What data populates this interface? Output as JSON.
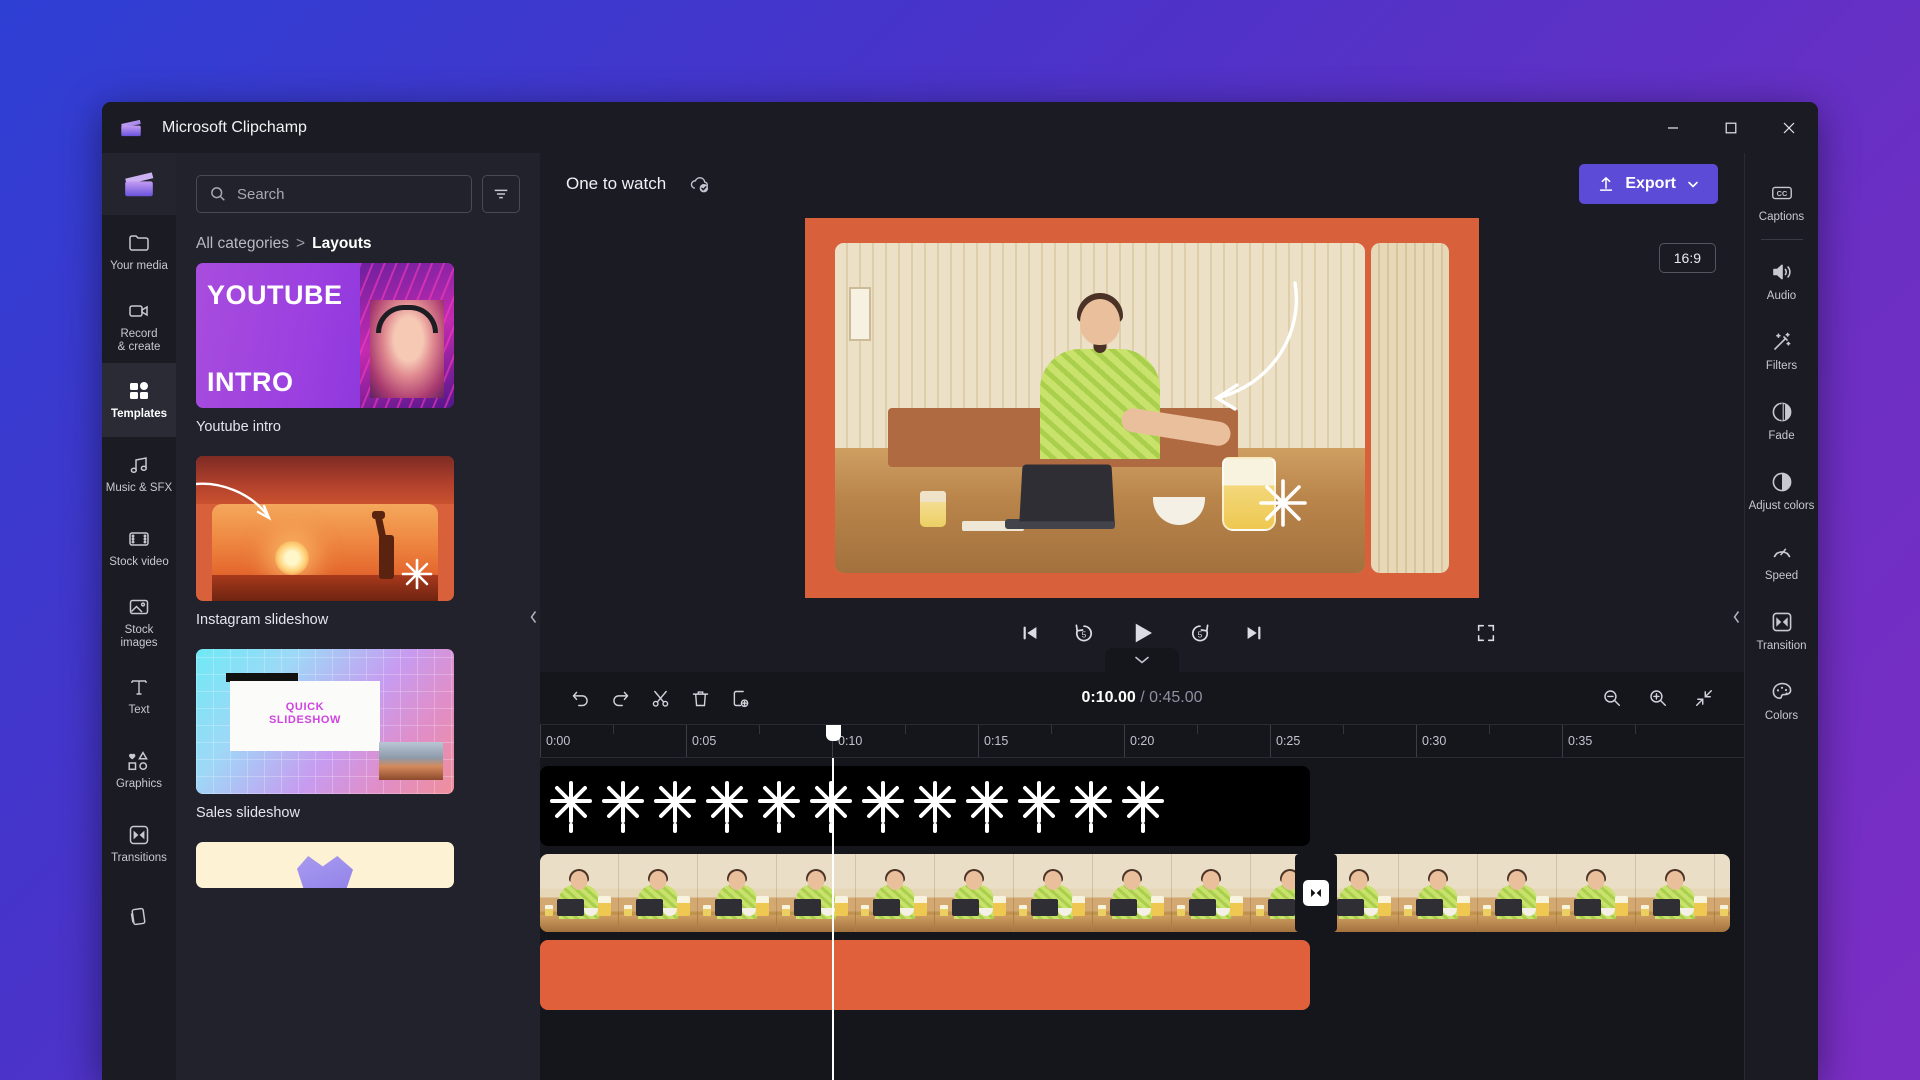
{
  "window": {
    "title": "Microsoft Clipchamp",
    "controls": {
      "minimize": "–",
      "maximize": "□",
      "close": "✕"
    }
  },
  "left_rail": {
    "logo_name": "clipchamp-logo",
    "items": [
      {
        "label": "Your media",
        "icon": "folder-icon",
        "active": false
      },
      {
        "label": "Record\n& create",
        "icon": "video-camera-icon",
        "active": false
      },
      {
        "label": "Templates",
        "icon": "templates-icon",
        "active": true
      },
      {
        "label": "Music & SFX",
        "icon": "music-note-icon",
        "active": false
      },
      {
        "label": "Stock video",
        "icon": "film-strip-icon",
        "active": false
      },
      {
        "label": "Stock\nimages",
        "icon": "image-icon",
        "active": false
      },
      {
        "label": "Text",
        "icon": "text-t-icon",
        "active": false
      },
      {
        "label": "Graphics",
        "icon": "shapes-icon",
        "active": false
      },
      {
        "label": "Transitions",
        "icon": "transition-icon",
        "active": false
      },
      {
        "label": "",
        "icon": "brand-kit-icon",
        "active": false
      }
    ]
  },
  "panel": {
    "search": {
      "placeholder": "Search",
      "value": ""
    },
    "filter_button": "filter-icon",
    "breadcrumb": {
      "root": "All categories",
      "separator": ">",
      "current": "Layouts"
    },
    "templates": [
      {
        "name": "Youtube intro",
        "thumb": "youtube-intro",
        "text_top": "YOUTUBE",
        "text_bottom": "INTRO"
      },
      {
        "name": "Instagram slideshow",
        "thumb": "instagram-slideshow"
      },
      {
        "name": "Sales slideshow",
        "thumb": "sales-slideshow",
        "overlay_text": "QUICK\nSLIDESHOW"
      },
      {
        "name": "",
        "thumb": "cream-card"
      }
    ]
  },
  "editor": {
    "project_title": "One to watch",
    "cloud_status_icon": "cloud-saved-icon",
    "export": {
      "label": "Export",
      "icon": "upload-icon",
      "chevron": "⌄",
      "color": "#5b4bd6"
    },
    "aspect_ratio": "16:9",
    "player_controls": [
      {
        "name": "skip-to-start",
        "icon": "skip-back-icon"
      },
      {
        "name": "rewind-5-seconds",
        "icon": "rewind-5-icon",
        "value": "5"
      },
      {
        "name": "play",
        "icon": "play-icon"
      },
      {
        "name": "forward-5-seconds",
        "icon": "forward-5-icon",
        "value": "5"
      },
      {
        "name": "skip-to-end",
        "icon": "skip-forward-icon"
      }
    ],
    "fullscreen_icon": "fullscreen-icon"
  },
  "timeline": {
    "collapse_icon": "chevron-down-icon",
    "tools": [
      {
        "name": "undo",
        "icon": "undo-icon"
      },
      {
        "name": "redo",
        "icon": "redo-icon"
      },
      {
        "name": "split",
        "icon": "scissors-icon"
      },
      {
        "name": "delete",
        "icon": "trash-icon"
      },
      {
        "name": "duplicate",
        "icon": "duplicate-icon"
      }
    ],
    "time": {
      "current": "0:10.00",
      "separator": "/",
      "total": "0:45.00"
    },
    "zoom_tools": [
      {
        "name": "zoom-out",
        "icon": "zoom-out-icon"
      },
      {
        "name": "zoom-in",
        "icon": "zoom-in-icon"
      },
      {
        "name": "fit-to-screen",
        "icon": "fit-screen-icon"
      }
    ],
    "ruler_labels": [
      "0:00",
      "0:05",
      "0:10",
      "0:15",
      "0:20",
      "0:25",
      "0:30",
      "0:35"
    ],
    "playhead_time": "0:10",
    "tracks": [
      {
        "name": "effect-track",
        "type": "sparkle",
        "label": ""
      },
      {
        "name": "video-track",
        "type": "video",
        "label": ""
      },
      {
        "name": "color-track",
        "type": "color",
        "label": "",
        "color": "#e0603b"
      }
    ],
    "transition_marker_icon": "transition-icon"
  },
  "right_rail": {
    "items": [
      {
        "label": "Captions",
        "icon": "cc-icon",
        "separator_after": true
      },
      {
        "label": "Audio",
        "icon": "speaker-icon",
        "separator_after": false
      },
      {
        "label": "Filters",
        "icon": "magic-wand-icon",
        "separator_after": false
      },
      {
        "label": "Fade",
        "icon": "fade-icon",
        "separator_after": false
      },
      {
        "label": "Adjust colors",
        "icon": "contrast-icon",
        "separator_after": false
      },
      {
        "label": "Speed",
        "icon": "speedometer-icon",
        "separator_after": false
      },
      {
        "label": "Transition",
        "icon": "transition-icon",
        "separator_after": false
      },
      {
        "label": "Colors",
        "icon": "palette-icon",
        "separator_after": false
      }
    ]
  },
  "colors": {
    "desktop_gradient_start": "#2e3fd4",
    "desktop_gradient_end": "#7b2ec4",
    "window_bg": "#1b1b23",
    "panel_bg": "#22222c",
    "timeline_bg": "#15151c",
    "accent": "#5b4bd6",
    "clip_orange": "#e0603b"
  }
}
